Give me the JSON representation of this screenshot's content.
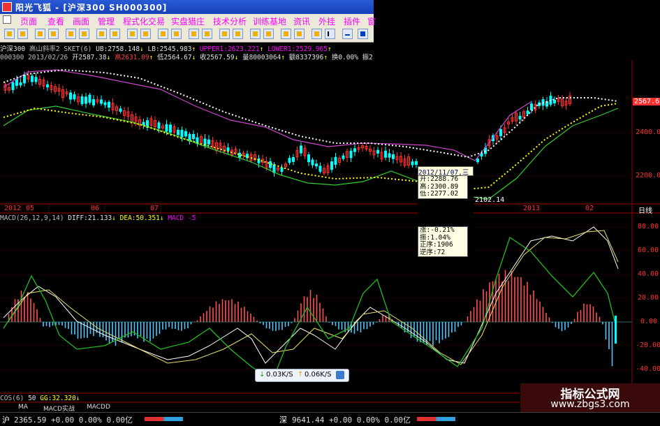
{
  "window": {
    "title": "阳光飞狐 - [沪深300  SH000300]"
  },
  "menu": [
    "页面",
    "查看",
    "画面",
    "管理",
    "程式化交易",
    "实盘猎庄",
    "技术分析",
    "训练基地",
    "资讯",
    "外挂",
    "插件",
    "窗"
  ],
  "info": {
    "row1": {
      "name": "沪深300",
      "indicator": "高山斜率2 SKET(6)",
      "ub": "UB:2758.148",
      "ub_arrow": "↓",
      "lb": "LB:2545.983",
      "lb_arrow": "↑",
      "upper": "UPPER1:2623.221",
      "upper_arrow": "↑",
      "lower": "LOWER1:2529.965",
      "lower_arrow": "↑"
    },
    "row2": {
      "code": "000300",
      "date": "2013/02/26",
      "open": "开2587.38",
      "open_arrow": "↓",
      "high": "高2631.09",
      "high_arrow": "↑",
      "low": "低2564.67",
      "low_arrow": "↓",
      "close": "收2567.59",
      "close_arrow": "↓",
      "vol": "量80003064",
      "vol_arrow": "↑",
      "amt": "额8337396",
      "amt_arrow": "↑",
      "turn": "换0.00%",
      "chg": "振2"
    }
  },
  "price_axis": {
    "current": "2567.6",
    "ticks": [
      "2400.0",
      "2200.0"
    ]
  },
  "time_axis": {
    "labels": [
      "2012",
      "05",
      "06",
      "07",
      "2013",
      "02",
      "日线"
    ]
  },
  "macd": {
    "label": "MACD(26,12,9,14)",
    "diff": "DIFF:21.133",
    "diff_arrow": "↓",
    "dea": "DEA:50.351",
    "dea_arrow": "↓",
    "macd": "MACD -5",
    "ticks": [
      "80.00",
      "60.00",
      "40.00",
      "20.00",
      "0.00",
      "-20.00",
      "-40.00"
    ]
  },
  "tooltip": {
    "date": "2012/11/07,三",
    "open": "开:2288.76",
    "high": "高:2300.89",
    "low": "低:2277.02",
    "close_part": "2102.14",
    "change": "涨:-0.21%",
    "amplitude": "振:1.04%",
    "order": "正序:1906",
    "reverse": "逆序:72"
  },
  "netspeed": {
    "down": "0.03K/S",
    "up": "0.06K/S"
  },
  "cos": {
    "label": "COS(6)",
    "val": "50",
    "gg": "GG:32.320",
    "gg_arrow": "↓"
  },
  "tabs": [
    "MA",
    "MACD实战",
    "MACDD"
  ],
  "status": {
    "sh_label": "沪",
    "sh": "2365.59 +0.00 0.00% 0.00亿",
    "sz_label": "深",
    "sz": "9641.44 +0.00 0.00% 0.00亿"
  },
  "watermark": {
    "line1": "指标公式网",
    "line2": "www.zbgs3.com"
  },
  "colors": {
    "up": "#ff3030",
    "down": "#00ffff",
    "ma_white": "#ffffff",
    "ma_yellow": "#ffff00",
    "band_magenta": "#cc44cc",
    "band_green": "#33cc33"
  }
}
